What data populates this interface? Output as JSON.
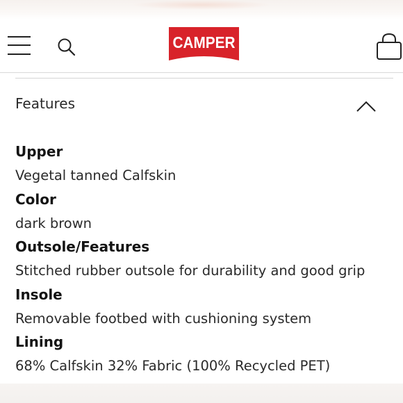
{
  "header": {
    "brand": "CAMPER",
    "brand_color": "#d8232a",
    "menu_icon": "hamburger-icon",
    "search_icon": "search-icon",
    "cart_icon": "shopping-bag-icon"
  },
  "section": {
    "title": "Features",
    "toggle_icon": "chevron-up-icon",
    "expanded": true
  },
  "specs": [
    {
      "label": "Upper",
      "value": "Vegetal tanned Calfskin"
    },
    {
      "label": "Color",
      "value": "dark brown"
    },
    {
      "label": "Outsole/Features",
      "value": "Stitched rubber outsole for durability and good grip"
    },
    {
      "label": "Insole",
      "value": "Removable footbed with cushioning system"
    },
    {
      "label": "Lining",
      "value": "68% Calfskin 32% Fabric (100% Recycled PET)"
    }
  ]
}
